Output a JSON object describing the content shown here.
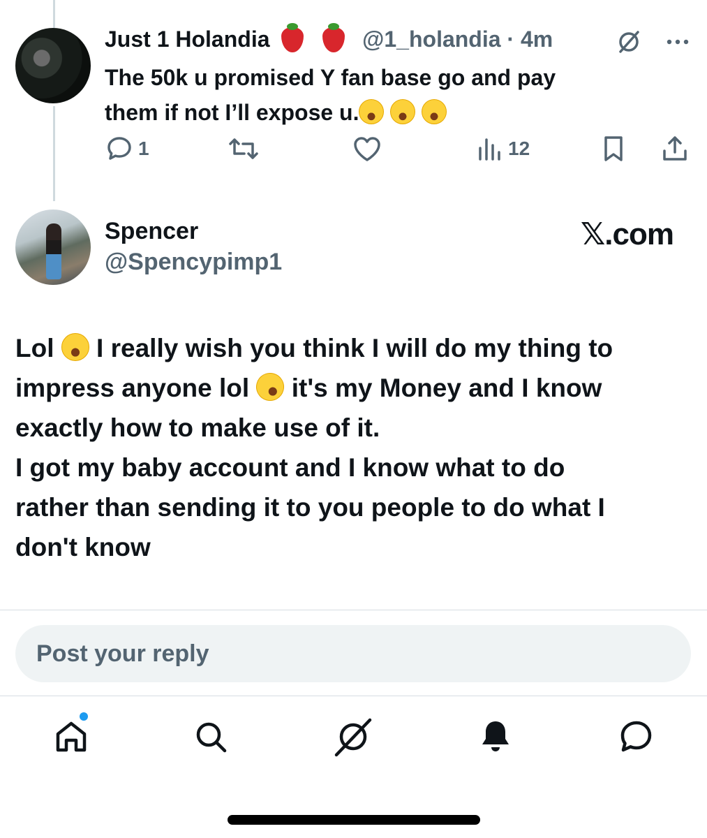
{
  "reply_tweet": {
    "display_name": "Just 1 Holandia",
    "handle": "@1_holandia",
    "separator": "·",
    "time": "4m",
    "text_line1": "The 50k u promised Y fan base go and pay",
    "text_line2": "them if not I’ll expose u.",
    "reply_count": "1",
    "view_count": "12"
  },
  "quoted_post": {
    "display_name": "Spencer",
    "handle": "@Spencypimp1",
    "source_label": "𝕏.com",
    "body_line1_a": "Lol",
    "body_line1_b": "I really wish you think I will do my thing to",
    "body_line2_a": "impress anyone lol",
    "body_line2_b": "it's my Money and I know",
    "body_line3": "exactly how to make use of it.",
    "body_line4": "I got my baby account and I know what to do",
    "body_line5": "rather than sending it to you people to do what I",
    "body_line6": "don't know"
  },
  "composer": {
    "placeholder": "Post your reply"
  },
  "icons": {
    "reply": "reply-icon",
    "repost": "repost-icon",
    "like": "heart-icon",
    "views": "views-icon",
    "bookmark": "bookmark-icon",
    "share": "share-icon",
    "grok": "grok-icon",
    "more": "more-icon",
    "home": "home-icon",
    "search": "search-icon",
    "notifications": "bell-icon",
    "messages": "messages-icon"
  },
  "colors": {
    "accent": "#1d9bf0",
    "secondary_text": "#536471",
    "primary_text": "#0f1419"
  }
}
